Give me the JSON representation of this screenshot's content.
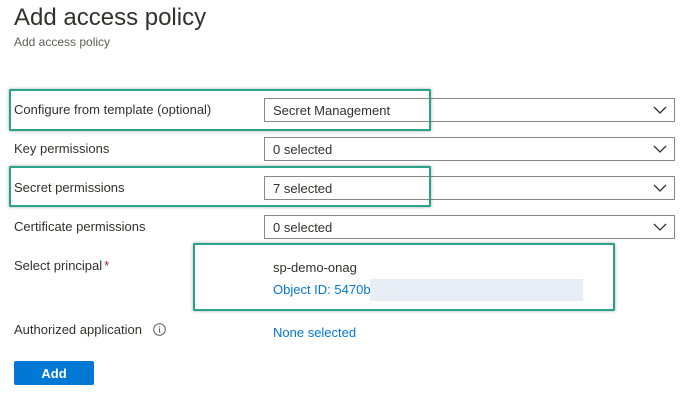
{
  "header": {
    "title": "Add access policy",
    "subtitle": "Add access policy"
  },
  "form": {
    "template": {
      "label": "Configure from template (optional)",
      "value": "Secret Management"
    },
    "key_permissions": {
      "label": "Key permissions",
      "value": "0 selected"
    },
    "secret_permissions": {
      "label": "Secret permissions",
      "value": "7 selected"
    },
    "certificate_permissions": {
      "label": "Certificate permissions",
      "value": "0 selected"
    },
    "principal": {
      "label": "Select principal",
      "required_marker": "*",
      "name": "sp-demo-onag",
      "object_id": "Object ID: 5470b"
    },
    "authorized_application": {
      "label": "Authorized application",
      "value": "None selected"
    }
  },
  "actions": {
    "add_label": "Add"
  },
  "icons": {
    "dropdown": "chevron-down-icon",
    "info": "info-icon"
  },
  "colors": {
    "accent": "#0078d4",
    "highlight": "#2aa38a",
    "required": "#a4262c"
  }
}
